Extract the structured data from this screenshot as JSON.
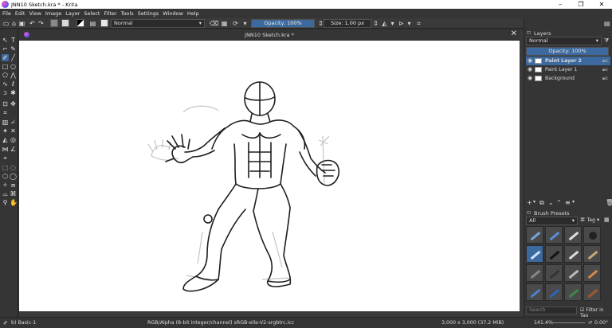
{
  "window": {
    "title": "JNN10 Sketch.kra * - Krita",
    "controls": [
      "–",
      "❐",
      "✕"
    ]
  },
  "menu": [
    "File",
    "Edit",
    "View",
    "Image",
    "Layer",
    "Select",
    "Filter",
    "Tools",
    "Settings",
    "Window",
    "Help"
  ],
  "toolbar": {
    "blend_mode": "Normal",
    "opacity_label": "Opacity: 100%",
    "size_label": "Size: 1.00 px"
  },
  "document": {
    "tab_title": "JNN10 Sketch.kra *"
  },
  "layers_docker": {
    "title": "Layers",
    "blend_mode": "Normal",
    "opacity_label": "Opacity:  100%",
    "layers": [
      {
        "name": "Paint Layer 2",
        "selected": true
      },
      {
        "name": "Paint Layer 1",
        "selected": false
      },
      {
        "name": "Background",
        "selected": false
      }
    ]
  },
  "brush_presets": {
    "title": "Brush Presets",
    "filter": "All",
    "tag_label": "Tag",
    "search_placeholder": "Search",
    "filter_in_tag": "Filter in Tag"
  },
  "status": {
    "brush": "b) Basic-1",
    "color_info": "RGB/Alpha (8-bit integer/channel)  sRGB-elle-V2-srgbtrc.icc",
    "dimensions": "3,000 x 3,000 (37.2 MiB)",
    "zoom": "141.4%",
    "rotation": "0.00°"
  },
  "colors": {
    "accent": "#3d6a9e",
    "bg": "#2f2f2f",
    "panel": "#353535",
    "canvas_bg": "#6b6b6b",
    "paper": "#ffffff"
  }
}
